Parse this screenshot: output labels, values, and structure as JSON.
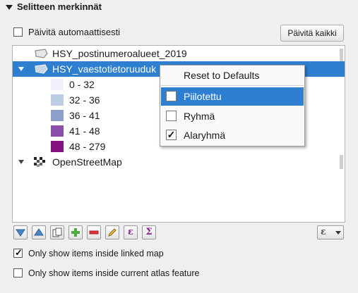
{
  "panel": {
    "title": "Selitteen merkinnät"
  },
  "auto_update": {
    "label": "Päivitä automaattisesti",
    "checked": false
  },
  "update_all_button": "Päivitä kaikki",
  "tree": {
    "items": [
      {
        "label": "HSY_postinumeroalueet_2019",
        "icon": "polygon-layer-icon"
      },
      {
        "label": "HSY_vaestotietoruuduk",
        "icon": "polygon-layer-icon",
        "selected": true
      },
      {
        "label": "OpenStreetMap",
        "icon": "raster-layer-icon"
      }
    ],
    "classes": [
      {
        "label": "0 - 32",
        "color": "#f3f0f8"
      },
      {
        "label": "32 - 36",
        "color": "#bccde3"
      },
      {
        "label": "36 - 41",
        "color": "#8d9fcb"
      },
      {
        "label": "41 - 48",
        "color": "#8a4fa8"
      },
      {
        "label": "48 - 279",
        "color": "#83117e"
      }
    ]
  },
  "context_menu": {
    "items": [
      {
        "label": "Reset to Defaults"
      },
      {
        "label": "Piilotettu",
        "checked": false,
        "highlighted": true
      },
      {
        "label": "Ryhmä",
        "checked": false
      },
      {
        "label": "Alaryhmä",
        "checked": true
      }
    ]
  },
  "toolbar": {
    "buttons": [
      "move-down-icon",
      "move-up-icon",
      "add-group-icon",
      "add-item-icon",
      "remove-item-icon",
      "edit-item-icon",
      "expression-icon",
      "sum-icon"
    ],
    "filter_button_icon": "expression-filter-icon"
  },
  "options": {
    "linked_map": {
      "label": "Only show items inside linked map",
      "checked": true
    },
    "atlas": {
      "label": "Only show items inside current atlas feature",
      "checked": false
    }
  }
}
